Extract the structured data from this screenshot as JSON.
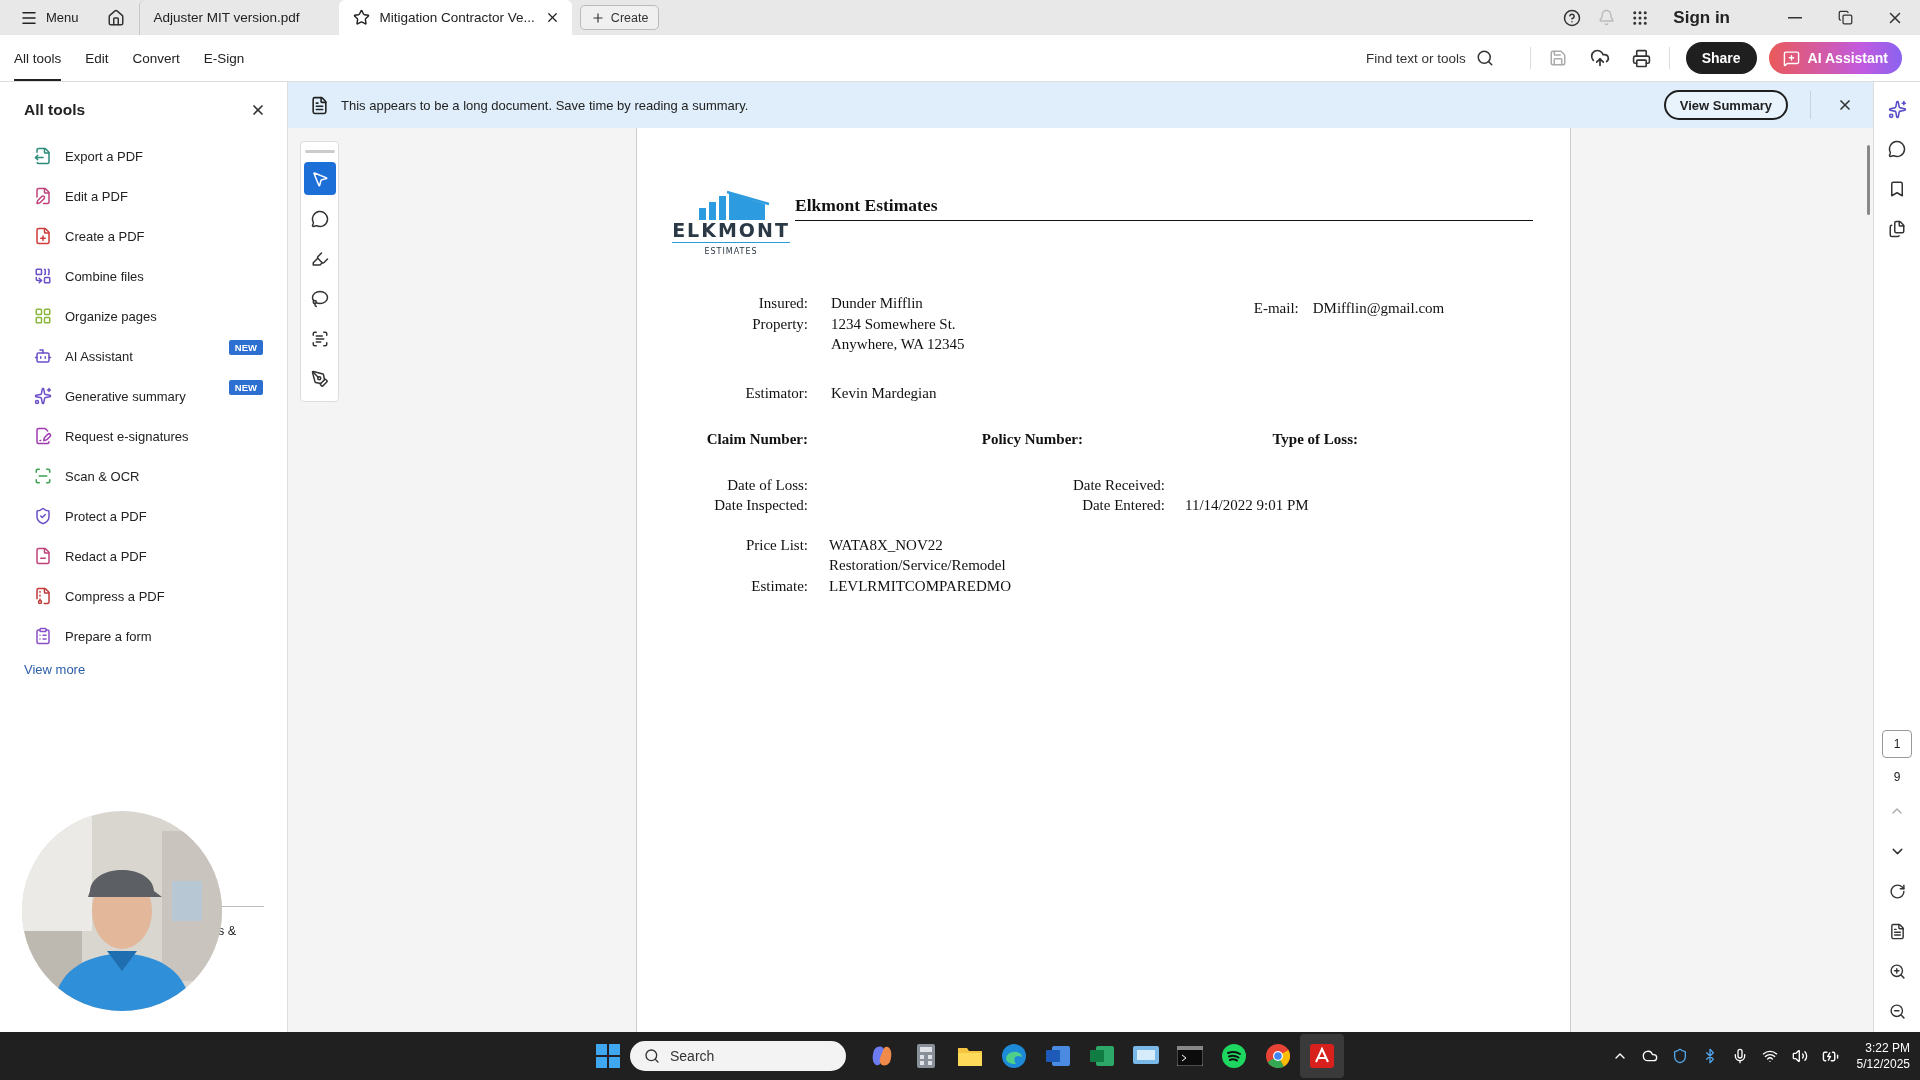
{
  "title_bar": {
    "menu_label": "Menu",
    "tabs": [
      {
        "label": "Adjuster MIT version.pdf",
        "selected": false
      },
      {
        "label": "Mitigation Contractor Ve...",
        "selected": true
      }
    ],
    "create_label": "Create",
    "sign_in": "Sign in"
  },
  "toolbar": {
    "tabs": [
      {
        "label": "All tools",
        "selected": true
      },
      {
        "label": "Edit",
        "selected": false
      },
      {
        "label": "Convert",
        "selected": false
      },
      {
        "label": "E-Sign",
        "selected": false
      }
    ],
    "search_label": "Find text or tools",
    "share": "Share",
    "ai_assistant": "AI Assistant"
  },
  "banner": {
    "message": "This appears to be a long document. Save time by reading a summary.",
    "button": "View Summary"
  },
  "sidebar": {
    "title": "All tools",
    "items": [
      {
        "label": "Export a PDF"
      },
      {
        "label": "Edit a PDF"
      },
      {
        "label": "Create a PDF"
      },
      {
        "label": "Combine files"
      },
      {
        "label": "Organize pages"
      },
      {
        "label": "AI Assistant",
        "badge": "NEW"
      },
      {
        "label": "Generative summary",
        "badge": "NEW"
      },
      {
        "label": "Request e-signatures"
      },
      {
        "label": "Scan & OCR"
      },
      {
        "label": "Protect a PDF"
      },
      {
        "label": "Redact a PDF"
      },
      {
        "label": "Compress a PDF"
      },
      {
        "label": "Prepare a form"
      }
    ],
    "view_more": "View more",
    "covered_text": "s &"
  },
  "tool_palette": [
    {
      "selected": true
    },
    {
      "selected": false
    },
    {
      "selected": false
    },
    {
      "selected": false
    },
    {
      "selected": false
    },
    {
      "selected": false
    }
  ],
  "document": {
    "logo_name": "ELKMONT",
    "logo_tagline": "ESTIMATES",
    "company": "Elkmont Estimates",
    "contact": [
      {
        "label": "Insured:",
        "lines": [
          "Dunder Mifflin"
        ]
      },
      {
        "label": "Property:",
        "lines": [
          "1234 Somewhere St.",
          "Anywhere, WA 12345"
        ]
      }
    ],
    "email": {
      "label": "E-mail:",
      "value": "DMifflin@gmail.com"
    },
    "estimator": {
      "label": "Estimator:",
      "value": "Kevin Mardegian"
    },
    "claim_fields": [
      "Claim Number:",
      "Policy Number:",
      "Type of Loss:"
    ],
    "dates_left": [
      "Date of Loss:",
      "Date Inspected:"
    ],
    "dates_right": [
      {
        "label": "Date Received:"
      },
      {
        "label": "Date Entered:",
        "value": "11/14/2022 9:01 PM"
      }
    ],
    "price": [
      {
        "label": "Price List:",
        "lines": [
          "WATA8X_NOV22",
          "Restoration/Service/Remodel"
        ]
      },
      {
        "label": "Estimate:",
        "lines": [
          "LEVLRMITCOMPAREDMO"
        ]
      }
    ]
  },
  "page_nav": {
    "current": "1",
    "total": "9"
  },
  "taskbar": {
    "search_placeholder": "Search",
    "time": "3:22 PM",
    "date": "5/12/2025"
  }
}
